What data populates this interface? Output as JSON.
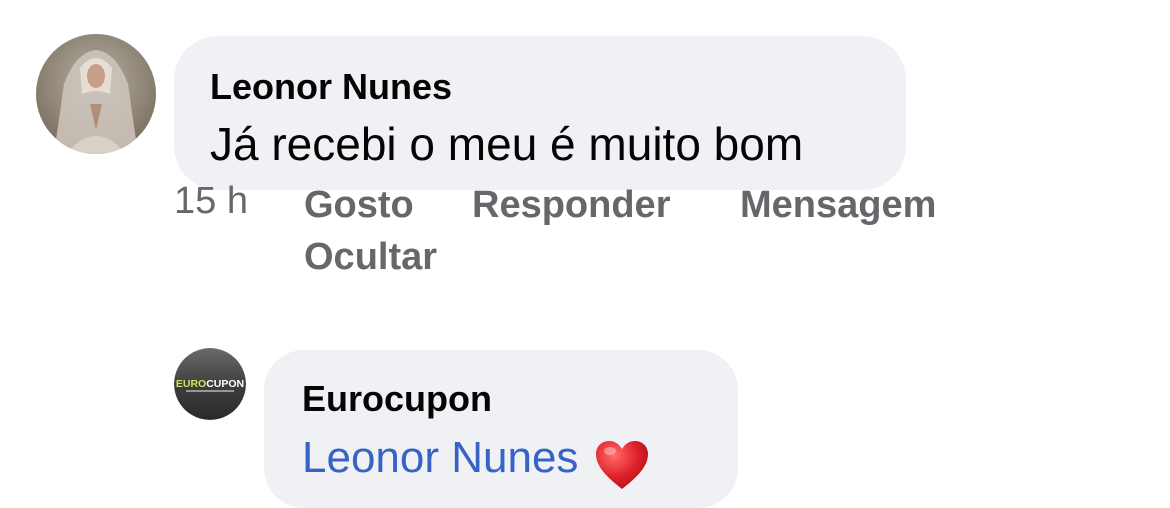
{
  "comments": [
    {
      "author": "Leonor Nunes",
      "text": "Já recebi o meu é muito bom",
      "time": "15 h",
      "actions": {
        "like": "Gosto",
        "reply": "Responder",
        "message": "Mensagem",
        "hide": "Ocultar"
      }
    }
  ],
  "reply": {
    "author": "Eurocupon",
    "mention": "Leonor Nunes",
    "emoji": "heart-icon",
    "avatar_logo": "EUROCUPON"
  },
  "colors": {
    "bubble": "#f0f1f4",
    "mention": "#3763c5",
    "meta": "#65676b",
    "heart": "#e0202a"
  }
}
